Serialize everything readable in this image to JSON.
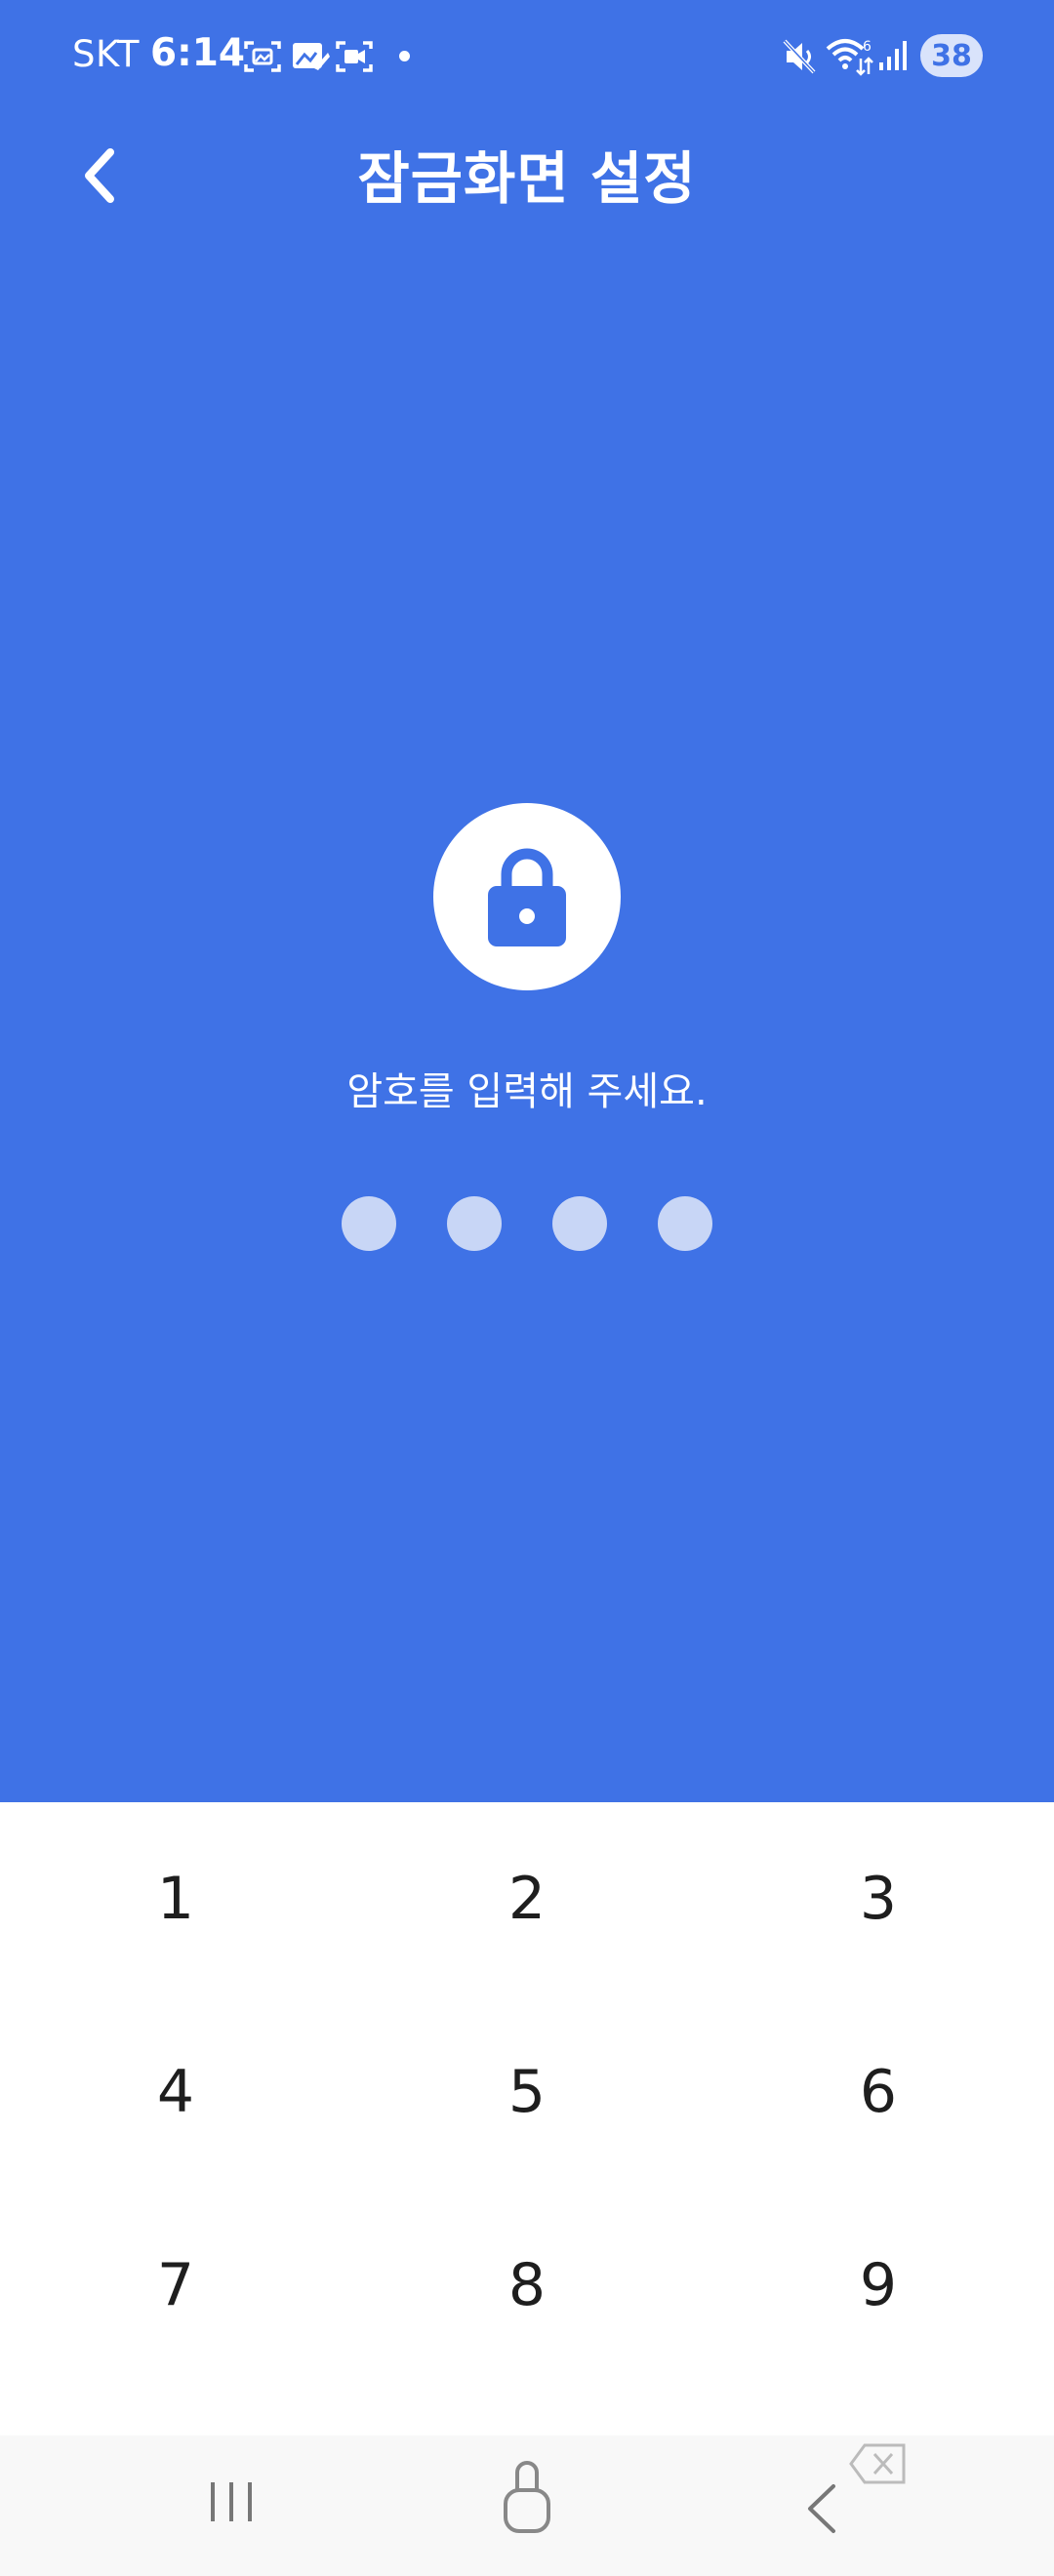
{
  "status_bar": {
    "carrier": "SKT",
    "time": "6:14",
    "battery": "38",
    "icons": [
      "screenshot-icon",
      "gallery-icon",
      "screen-record-icon",
      "notification-dot",
      "mute-icon",
      "wifi-icon",
      "signal-icon",
      "battery-icon"
    ]
  },
  "header": {
    "title": "잠금화면 설정",
    "back_icon": "chevron-left-icon"
  },
  "lock": {
    "icon": "lock-icon",
    "prompt": "암호를 입력해 주세요.",
    "pin_length": 4,
    "pin_entered": 0
  },
  "keypad": {
    "keys": [
      "1",
      "2",
      "3",
      "4",
      "5",
      "6",
      "7",
      "8",
      "9"
    ]
  },
  "nav_bar": {
    "icons": [
      "recent-apps-icon",
      "home-icon",
      "back-icon",
      "keyboard-delete-icon"
    ]
  },
  "colors": {
    "accent": "#3f72e6",
    "pin_dot": "#c8d6f6",
    "keypad_bg": "#ffffff",
    "nav_bg": "#f8f8f8"
  }
}
